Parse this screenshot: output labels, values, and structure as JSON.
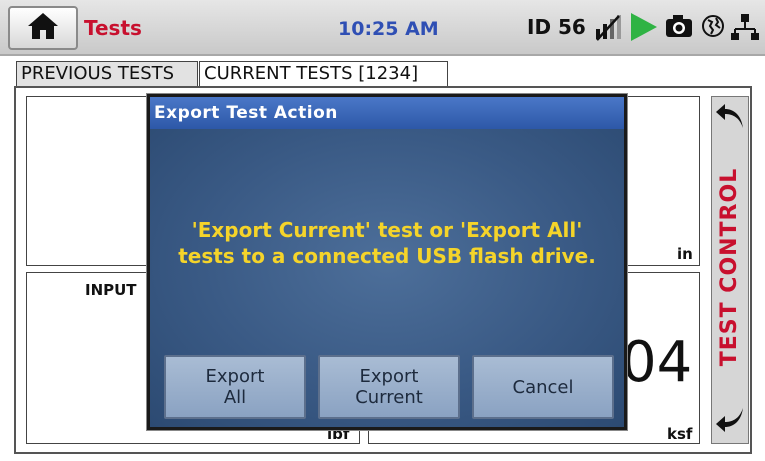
{
  "header": {
    "title": "Tests",
    "time": "10:25 AM",
    "device_id": "ID 56",
    "icons": [
      "home-icon",
      "wireless-off-icon",
      "play-icon",
      "camera-icon",
      "globe-icon",
      "network-icon"
    ],
    "colors": {
      "title": "#c8102e",
      "time": "#2f4fb4",
      "play": "#2fb344"
    }
  },
  "tabs": [
    {
      "label": "PREVIOUS TESTS",
      "active": false
    },
    {
      "label": "CURRENT TESTS [1234]",
      "active": true
    }
  ],
  "panels": {
    "top_left_unit": "in",
    "bottom_left_label": "INPUT",
    "bottom_left_unit": "lbf",
    "bottom_right_value": "04",
    "bottom_right_unit": "ksf"
  },
  "side_control": {
    "label": "TEST CONTROL",
    "icons": [
      "arrow-left-up-icon",
      "arrow-left-down-icon"
    ]
  },
  "dialog": {
    "title": "Export Test Action",
    "message": "'Export Current' test or 'Export All' tests to a connected USB flash drive.",
    "buttons": {
      "export_all": "Export\nAll",
      "export_current": "Export\nCurrent",
      "cancel": "Cancel"
    },
    "colors": {
      "message": "#f5d42a",
      "titlebar": "#3a66b8"
    }
  }
}
